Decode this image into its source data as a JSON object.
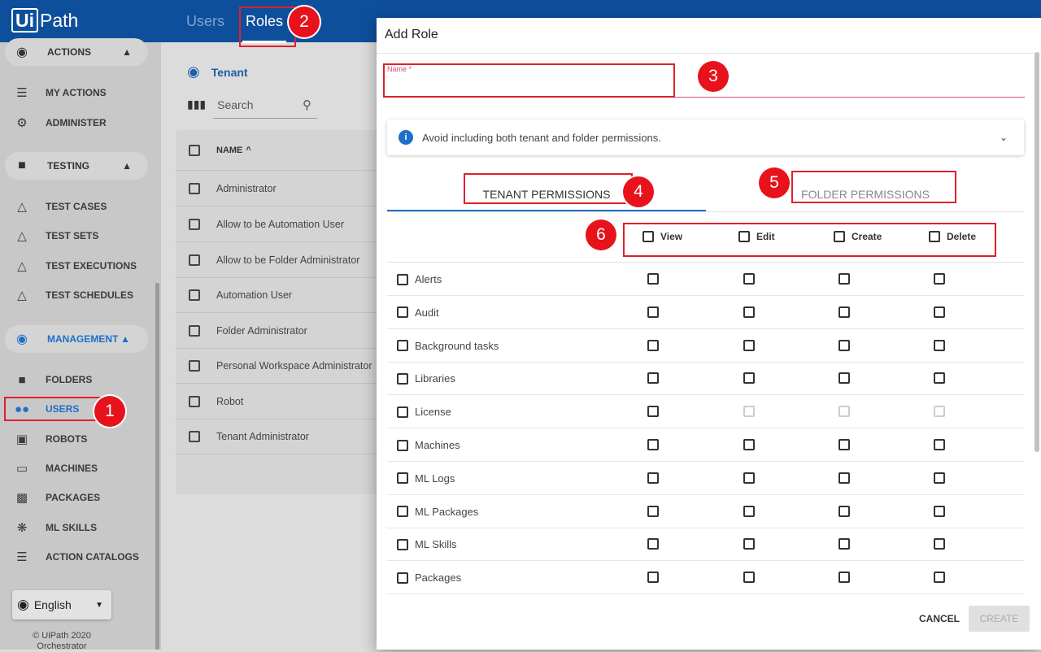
{
  "app": {
    "brand": "UiPath",
    "brand_ui": "Ui",
    "brand_path": "Path"
  },
  "top_tabs": [
    {
      "label": "Users"
    },
    {
      "label": "Roles"
    }
  ],
  "sidebar": {
    "sections": [
      {
        "label": "ACTIONS",
        "icon": "globe-icon"
      },
      {
        "label": "TESTING",
        "icon": "folder-icon"
      },
      {
        "label": "MANAGEMENT",
        "icon": "globe-icon"
      }
    ],
    "items": [
      {
        "label": "MY ACTIONS",
        "icon": "list-check-icon"
      },
      {
        "label": "ADMINISTER",
        "icon": "list-gear-icon"
      },
      {
        "label": "TEST CASES",
        "icon": "flask-icon"
      },
      {
        "label": "TEST SETS",
        "icon": "flask-stack-icon"
      },
      {
        "label": "TEST EXECUTIONS",
        "icon": "flask-play-icon"
      },
      {
        "label": "TEST SCHEDULES",
        "icon": "flask-clock-icon"
      },
      {
        "label": "FOLDERS",
        "icon": "folder-icon"
      },
      {
        "label": "USERS",
        "icon": "users-icon"
      },
      {
        "label": "ROBOTS",
        "icon": "robot-icon"
      },
      {
        "label": "MACHINES",
        "icon": "monitor-icon"
      },
      {
        "label": "PACKAGES",
        "icon": "package-icon"
      },
      {
        "label": "ML SKILLS",
        "icon": "atom-icon"
      },
      {
        "label": "ACTION CATALOGS",
        "icon": "catalog-icon"
      }
    ],
    "language": "English",
    "copyright": "© UiPath 2020",
    "product": "Orchestrator"
  },
  "roles_panel": {
    "breadcrumb": "Tenant",
    "search_placeholder": "Search",
    "column_name": "NAME",
    "sort_arrow": "^",
    "roles": [
      "Administrator",
      "Allow to be Automation User",
      "Allow to be Folder Administrator",
      "Automation User",
      "Folder Administrator",
      "Personal Workspace Administrator",
      "Robot",
      "Tenant Administrator"
    ]
  },
  "modal": {
    "title": "Add Role",
    "name_label": "Name *",
    "name_value": "",
    "info_text": "Avoid including both tenant and folder permissions.",
    "tabs": {
      "tenant": "TENANT PERMISSIONS",
      "folder": "FOLDER PERMISSIONS"
    },
    "columns": [
      "View",
      "Edit",
      "Create",
      "Delete"
    ],
    "permissions": [
      {
        "label": "Alerts",
        "disabled": [
          false,
          false,
          false,
          false
        ]
      },
      {
        "label": "Audit",
        "disabled": [
          false,
          false,
          false,
          false
        ]
      },
      {
        "label": "Background tasks",
        "disabled": [
          false,
          false,
          false,
          false
        ]
      },
      {
        "label": "Libraries",
        "disabled": [
          false,
          false,
          false,
          false
        ]
      },
      {
        "label": "License",
        "disabled": [
          false,
          true,
          true,
          true
        ]
      },
      {
        "label": "Machines",
        "disabled": [
          false,
          false,
          false,
          false
        ]
      },
      {
        "label": "ML Logs",
        "disabled": [
          false,
          false,
          false,
          false
        ]
      },
      {
        "label": "ML Packages",
        "disabled": [
          false,
          false,
          false,
          false
        ]
      },
      {
        "label": "ML Skills",
        "disabled": [
          false,
          false,
          false,
          false
        ]
      },
      {
        "label": "Packages",
        "disabled": [
          false,
          false,
          false,
          false
        ]
      }
    ],
    "cancel_label": "CANCEL",
    "create_label": "CREATE"
  },
  "callouts": [
    "1",
    "2",
    "3",
    "4",
    "5",
    "6"
  ],
  "colors": {
    "brand_blue": "#0e4f9c",
    "accent_blue": "#1d6fc9",
    "callout_red": "#e8121c",
    "required_pink": "#d64c7f"
  }
}
